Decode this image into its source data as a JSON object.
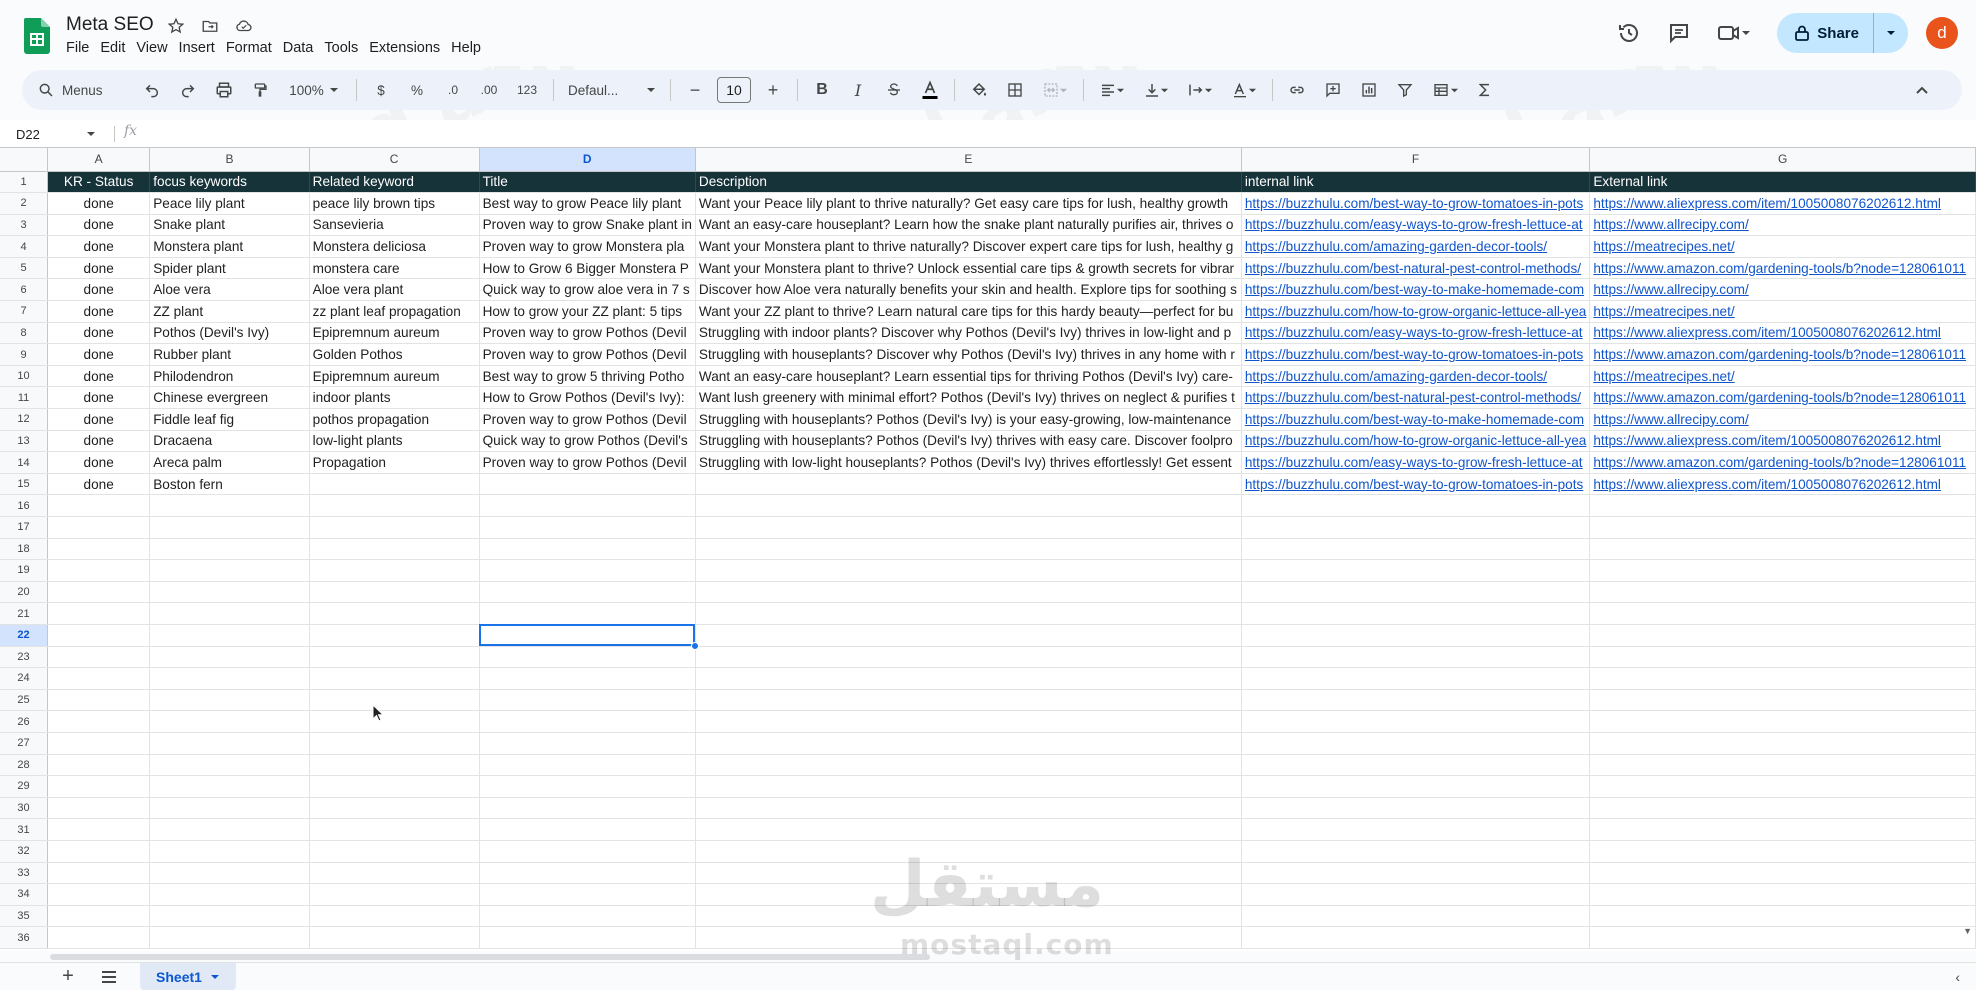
{
  "app": {
    "doc_title": "Meta SEO",
    "menus": [
      "File",
      "Edit",
      "View",
      "Insert",
      "Format",
      "Data",
      "Tools",
      "Extensions",
      "Help"
    ],
    "share_label": "Share",
    "avatar_letter": "d"
  },
  "toolbar": {
    "menus_label": "Menus",
    "zoom": "100%",
    "currency": "$",
    "percent": "%",
    "dec_decrease": ".0",
    "dec_increase": ".00",
    "number_format": "123",
    "font": "Defaul...",
    "font_size": "10",
    "minus": "−",
    "plus": "+",
    "bold": "B",
    "italic": "I"
  },
  "formula_bar": {
    "cell_ref": "D22",
    "fx": "fx",
    "value": ""
  },
  "grid": {
    "columns": [
      "A",
      "B",
      "C",
      "D",
      "E",
      "F",
      "G"
    ],
    "selected_column": "D",
    "selected_row": 22,
    "row_numbers": [
      1,
      2,
      3,
      4,
      5,
      6,
      7,
      8,
      9,
      10,
      11,
      12,
      13,
      14,
      15,
      16,
      17,
      18,
      19,
      20,
      21,
      22,
      23,
      24,
      25,
      26,
      27,
      28,
      29,
      30,
      31,
      32,
      33,
      34,
      35,
      36
    ],
    "header": [
      "KR -  Status",
      "focus keywords",
      "Related keyword",
      "Title",
      "Description",
      "internal link",
      "External link"
    ],
    "rows": [
      [
        "done",
        "Peace lily plant",
        "peace lily brown tips",
        "Best way to grow Peace lily plant",
        "Want your Peace lily plant to thrive naturally? Get easy care tips for lush, healthy growth",
        "https://buzzhulu.com/best-way-to-grow-tomatoes-in-pots",
        "https://www.aliexpress.com/item/1005008076202612.html"
      ],
      [
        "done",
        "Snake plant",
        "Sansevieria",
        "Proven way to grow Snake plant in",
        "Want an easy-care houseplant? Learn how the snake plant naturally purifies air, thrives o",
        "https://buzzhulu.com/easy-ways-to-grow-fresh-lettuce-at",
        "https://www.allrecipy.com/"
      ],
      [
        "done",
        "Monstera plant",
        "Monstera deliciosa",
        "Proven way to grow Monstera pla",
        "Want your Monstera plant to thrive naturally? Discover expert care tips for lush, healthy g",
        "https://buzzhulu.com/amazing-garden-decor-tools/",
        "https://meatrecipes.net/"
      ],
      [
        "done",
        "Spider plant",
        "monstera care",
        "How to Grow 6 Bigger Monstera P",
        "Want your Monstera plant to thrive? Unlock essential care tips & growth secrets for vibrar",
        "https://buzzhulu.com/best-natural-pest-control-methods/",
        "https://www.amazon.com/gardening-tools/b?node=128061011"
      ],
      [
        "done",
        "Aloe vera",
        "Aloe vera plant",
        "Quick way to grow aloe vera in 7 s",
        "Discover how Aloe vera naturally benefits your skin and health. Explore tips for soothing s",
        "https://buzzhulu.com/best-way-to-make-homemade-com",
        "https://www.allrecipy.com/"
      ],
      [
        "done",
        "ZZ plant",
        "zz plant leaf propagation",
        "How to grow your ZZ plant: 5 tips",
        "Want your ZZ plant to thrive? Learn natural care tips for this hardy beauty—perfect for bu",
        "https://buzzhulu.com/how-to-grow-organic-lettuce-all-yea",
        "https://meatrecipes.net/"
      ],
      [
        "done",
        "Pothos (Devil's Ivy)",
        "Epipremnum aureum",
        "Proven way to grow Pothos (Devil",
        "Struggling with indoor plants? Discover why Pothos (Devil's Ivy) thrives in low-light and p",
        "https://buzzhulu.com/easy-ways-to-grow-fresh-lettuce-at",
        "https://www.aliexpress.com/item/1005008076202612.html"
      ],
      [
        "done",
        "Rubber plant",
        "Golden Pothos",
        "Proven way to grow Pothos (Devil",
        "Struggling with houseplants? Discover why Pothos (Devil's Ivy) thrives in any home with r",
        "https://buzzhulu.com/best-way-to-grow-tomatoes-in-pots",
        "https://www.amazon.com/gardening-tools/b?node=128061011"
      ],
      [
        "done",
        "Philodendron",
        "Epipremnum aureum",
        "Best way to grow 5 thriving Potho",
        "Want an easy-care houseplant? Learn essential tips for thriving Pothos (Devil's Ivy) care-",
        "https://buzzhulu.com/amazing-garden-decor-tools/",
        "https://meatrecipes.net/"
      ],
      [
        "done",
        "Chinese evergreen",
        "indoor plants",
        "How to Grow Pothos (Devil's Ivy):",
        "Want lush greenery with minimal effort? Pothos (Devil's Ivy) thrives on neglect & purifies t",
        "https://buzzhulu.com/best-natural-pest-control-methods/",
        "https://www.amazon.com/gardening-tools/b?node=128061011"
      ],
      [
        "done",
        "Fiddle leaf fig",
        "pothos propagation",
        "Proven way to grow Pothos (Devil",
        "Struggling with houseplants? Pothos (Devil's Ivy) is your easy-growing, low-maintenance",
        "https://buzzhulu.com/best-way-to-make-homemade-com",
        "https://www.allrecipy.com/"
      ],
      [
        "done",
        "Dracaena",
        "low-light plants",
        "Quick way to grow Pothos (Devil's",
        "Struggling with houseplants? Pothos (Devil's Ivy) thrives with easy care. Discover foolpro",
        "https://buzzhulu.com/how-to-grow-organic-lettuce-all-yea",
        "https://www.aliexpress.com/item/1005008076202612.html"
      ],
      [
        "done",
        "Areca palm",
        "Propagation",
        "Proven way to grow Pothos (Devil",
        "Struggling with low-light houseplants? Pothos (Devil's Ivy) thrives effortlessly! Get essent",
        "https://buzzhulu.com/easy-ways-to-grow-fresh-lettuce-at",
        "https://www.amazon.com/gardening-tools/b?node=128061011"
      ],
      [
        "done",
        "Boston fern",
        "",
        "",
        "",
        "https://buzzhulu.com/best-way-to-grow-tomatoes-in-pots",
        "https://www.aliexpress.com/item/1005008076202612.html"
      ]
    ]
  },
  "sheets": {
    "active": "Sheet1"
  },
  "watermark": {
    "text": "mohmaed amin",
    "brand_ar": "مستقل",
    "brand_en": "mostaql.com"
  },
  "colors": {
    "header_fill": "#17333a",
    "link": "#1155cc",
    "selection": "#1a73e8",
    "share_bg": "#c2e7ff",
    "avatar": "#e8541c"
  }
}
